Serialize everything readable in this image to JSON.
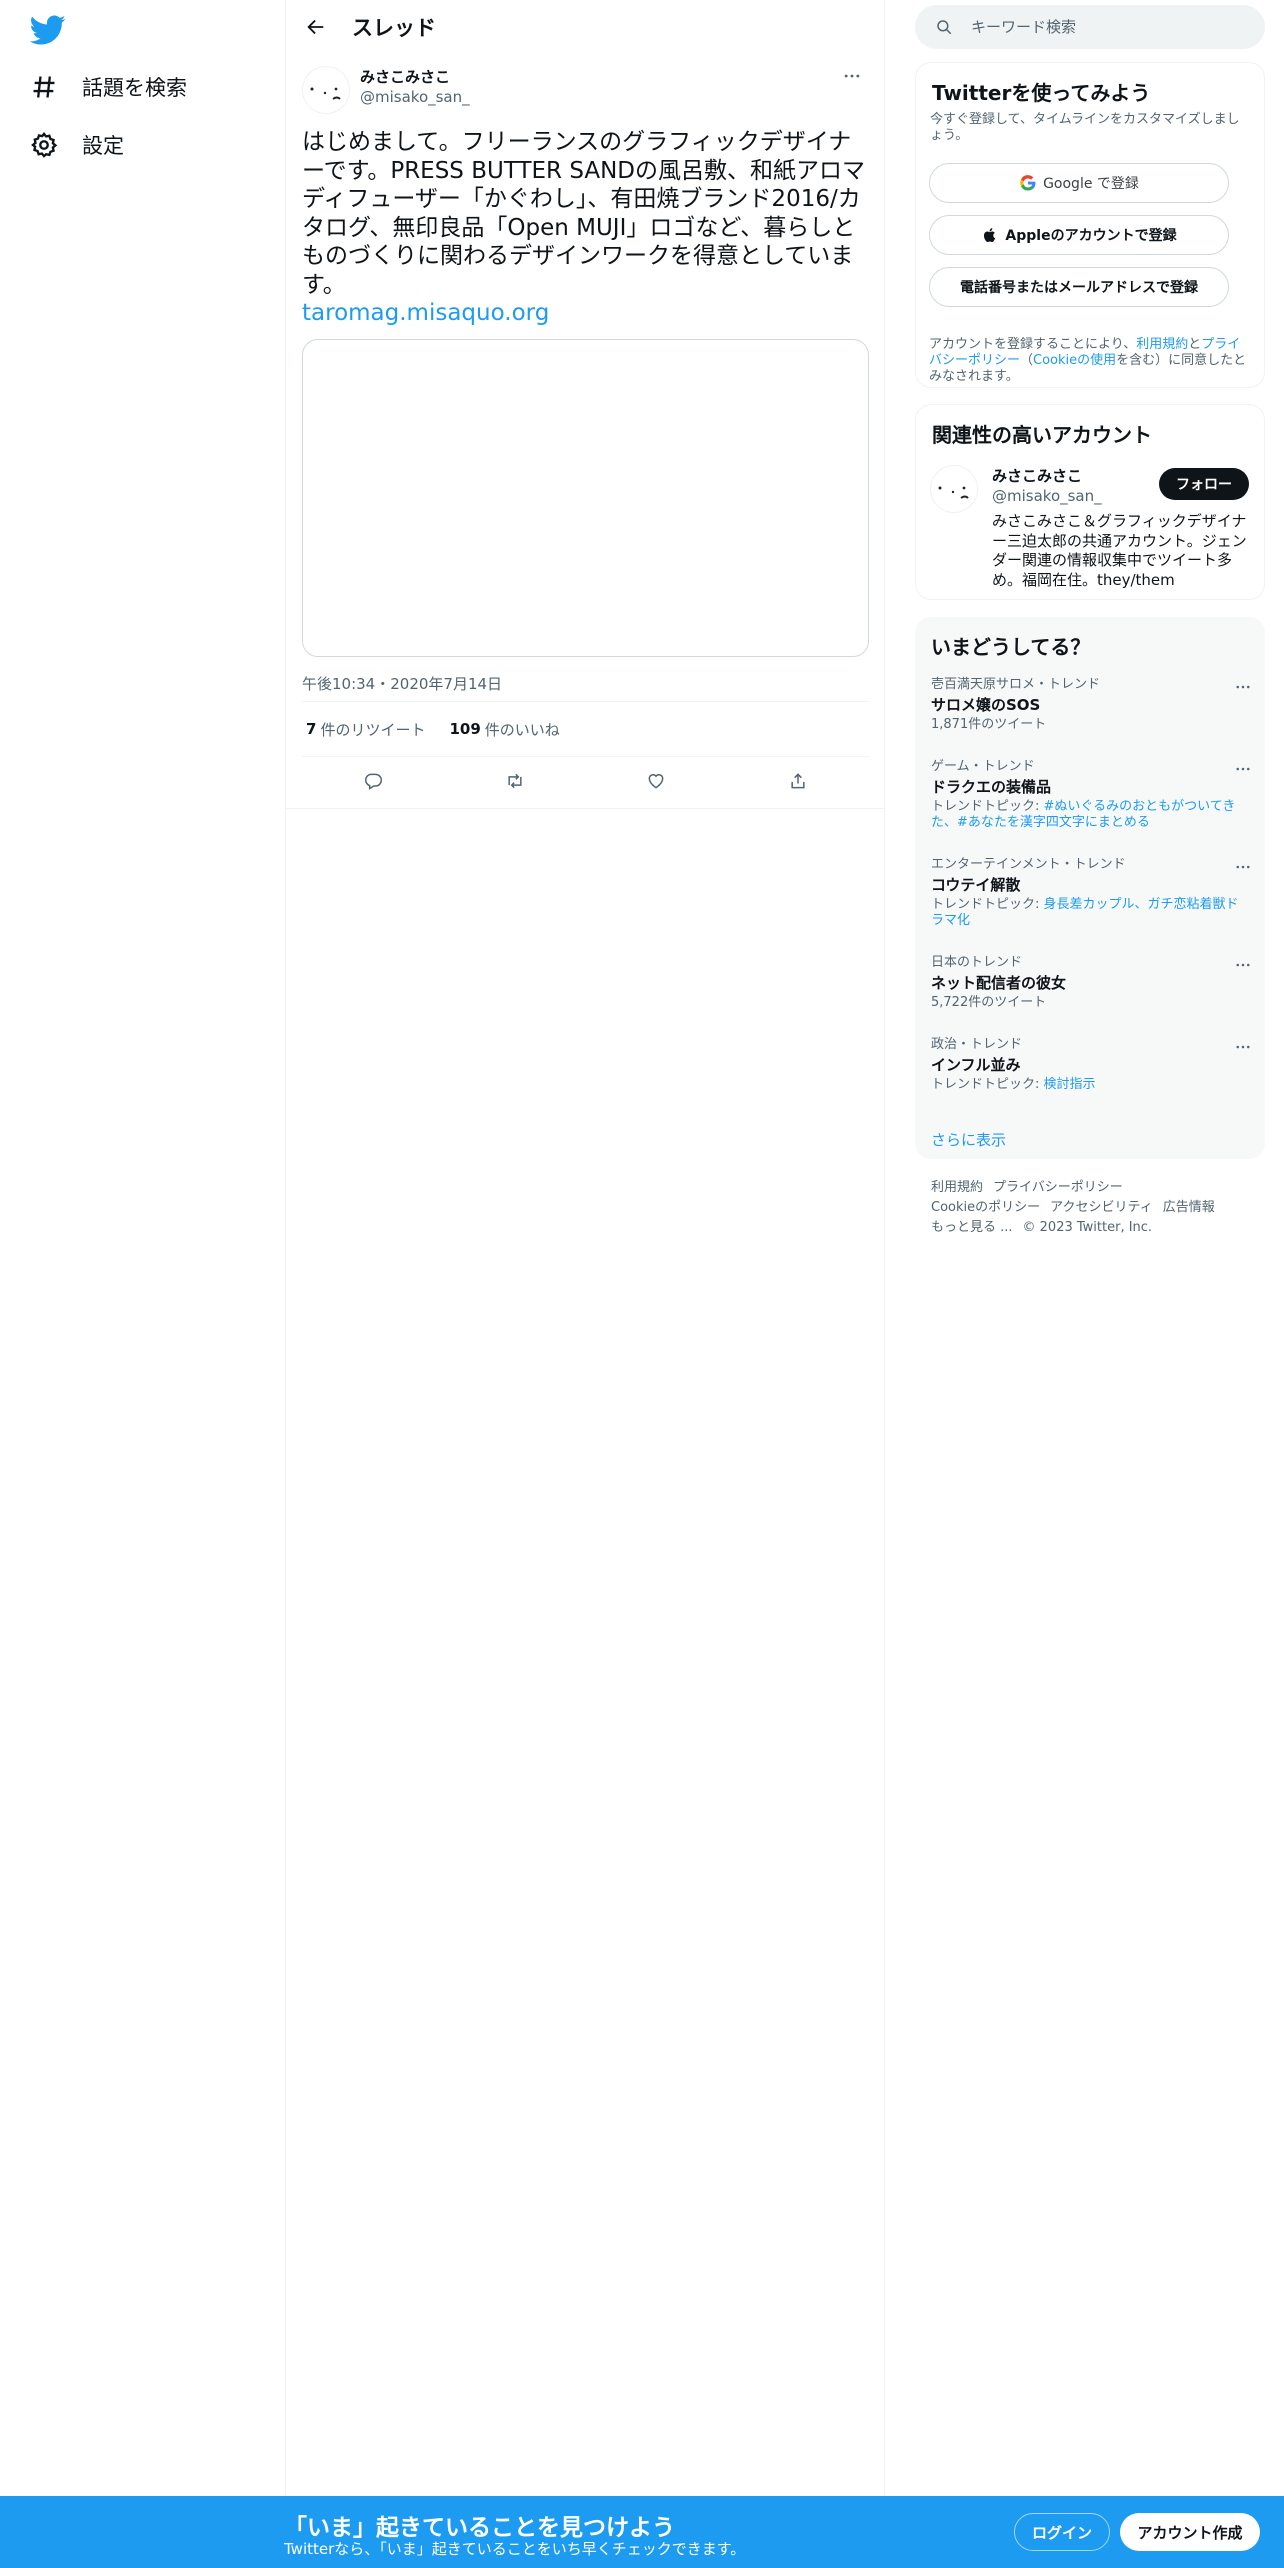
{
  "nav": {
    "explore_label": "話題を検索",
    "settings_label": "設定"
  },
  "header": {
    "title": "スレッド"
  },
  "tweet": {
    "author_name": "みさこみさこ",
    "author_handle": "@misako_san_",
    "text": "はじめまして。フリーランスのグラフィックデザイナーです。PRESS BUTTER SANDの風呂敷、和紙アロマディフューザー「かぐわし」、有田焼ブランド2016/カタログ、無印良品「Open MUJI」ロゴなど、暮らしとものづくりに関わるデザインワークを得意としています。",
    "link": "taromag.misaquo.org",
    "timestamp": "午後10:34・2020年7月14日",
    "retweet_count": "7",
    "retweet_label": "件のリツイート",
    "like_count": "109",
    "like_label": "件のいいね"
  },
  "search": {
    "placeholder": "キーワード検索"
  },
  "signup_box": {
    "title": "Twitterを使ってみよう",
    "subtitle": "今すぐ登録して、タイムラインをカスタマイズしましょう。",
    "google_label": "Google で登録",
    "apple_label": "Appleのアカウントで登録",
    "phone_label": "電話番号またはメールアドレスで登録",
    "legal_prefix": "アカウントを登録することにより、",
    "legal_terms": "利用規約",
    "legal_and": "と",
    "legal_privacy": "プライバシーポリシー",
    "legal_paren_open": "（",
    "legal_cookie": "Cookieの使用",
    "legal_suffix": "を含む）に同意したとみなされます。"
  },
  "related_box": {
    "title": "関連性の高いアカウント",
    "name": "みさこみさこ",
    "handle": "@misako_san_",
    "follow_label": "フォロー",
    "bio": "みさこみさこ＆グラフィックデザイナー三迫太郎の共通アカウント。ジェンダー関連の情報収集中でツイート多め。福岡在住。they/them"
  },
  "trends_box": {
    "title": "いまどうしてる？",
    "trends": [
      {
        "meta": "壱百満天原サロメ・トレンド",
        "name": "サロメ嬢のSOS",
        "sub": "1,871件のツイート",
        "hl": ""
      },
      {
        "meta": "ゲーム・トレンド",
        "name": "ドラクエの装備品",
        "sub": "トレンドトピック: ",
        "hl": "#ぬいぐるみのおともがついてきた、#あなたを漢字四文字にまとめる"
      },
      {
        "meta": "エンターテインメント・トレンド",
        "name": "コウテイ解散",
        "sub": "トレンドトピック: ",
        "hl": "身長差カップル、ガチ恋粘着獣ドラマ化"
      },
      {
        "meta": "日本のトレンド",
        "name": "ネット配信者の彼女",
        "sub": "5,722件のツイート",
        "hl": ""
      },
      {
        "meta": "政治・トレンド",
        "name": "インフル並み",
        "sub": "トレンドトピック: ",
        "hl": "検討指示"
      }
    ],
    "show_more": "さらに表示"
  },
  "footer": {
    "terms": "利用規約",
    "privacy": "プライバシーポリシー",
    "cookie": "Cookieのポリシー",
    "accessibility": "アクセシビリティ",
    "ads": "広告情報",
    "more": "もっと見る ...",
    "copyright": "© 2023 Twitter, Inc."
  },
  "bottom_bar": {
    "title": "「いま」起きていることを見つけよう",
    "subtitle": "Twitterなら、「いま」起きていることをいち早くチェックできます。",
    "login_label": "ログイン",
    "signup_label": "アカウント作成"
  },
  "colors": {
    "accent": "#1d9bf0",
    "text": "#0f1419",
    "muted": "#536471"
  }
}
